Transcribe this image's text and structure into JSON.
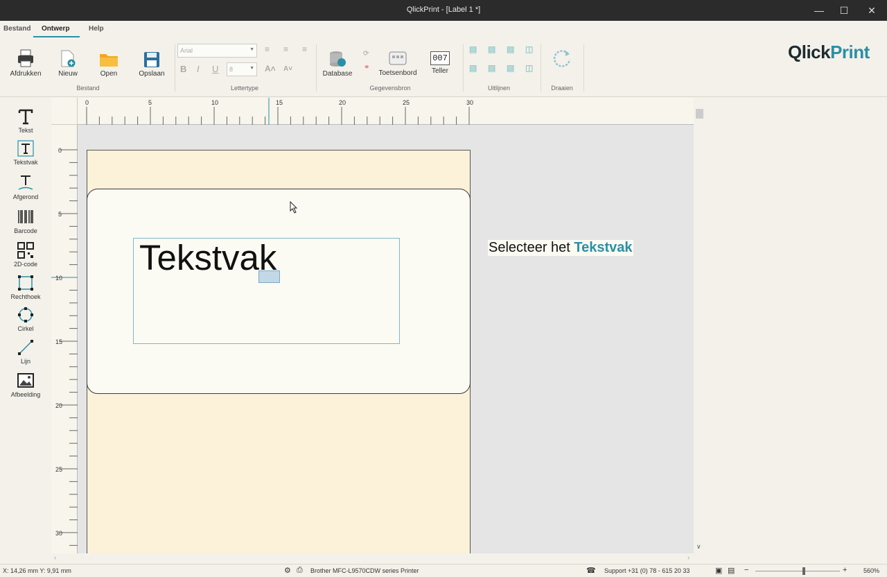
{
  "window": {
    "title": "QlickPrint - [Label 1 *]"
  },
  "menu": {
    "tabs": [
      "Bestand",
      "Ontwerp",
      "Help"
    ]
  },
  "ribbon": {
    "bestand": {
      "buttons": [
        "Afdrukken",
        "Nieuw",
        "Open",
        "Opslaan"
      ],
      "label": "Bestand"
    },
    "lettertype": {
      "font": "Arial",
      "size": "8",
      "label": "Lettertype"
    },
    "gegevensbron": {
      "buttons": [
        "Database",
        "Toetsenbord",
        "Teller"
      ],
      "label": "Gegevensbron",
      "counter": "007"
    },
    "uitlijnen": {
      "label": "Uitlijnen"
    },
    "draaien": {
      "label": "Draaien"
    }
  },
  "logo": {
    "part1": "Qlick",
    "part2": "Print"
  },
  "tools": [
    "Tekst",
    "Tekstvak",
    "Afgerond",
    "Barcode",
    "2D-code",
    "Rechthoek",
    "Cirkel",
    "Lijn",
    "Afbeelding"
  ],
  "ruler": {
    "h_labels": [
      "0",
      "5",
      "10",
      "15",
      "20",
      "25",
      "30"
    ],
    "v_labels": [
      "0",
      "5",
      "10",
      "15",
      "20",
      "25",
      "30"
    ]
  },
  "canvas": {
    "textbox_text": "Tekstvak",
    "hint_prefix": "Selecteer het",
    "hint_highlight": "Tekstvak"
  },
  "status": {
    "coords": "X: 14,26 mm Y: 9,91 mm",
    "printer": "Brother MFC-L9570CDW series Printer",
    "support": "Support +31 (0) 78 - 615 20 33",
    "zoom": "560%"
  },
  "colors": {
    "accent": "#2a8fa6",
    "label": "#fcf1d9"
  }
}
